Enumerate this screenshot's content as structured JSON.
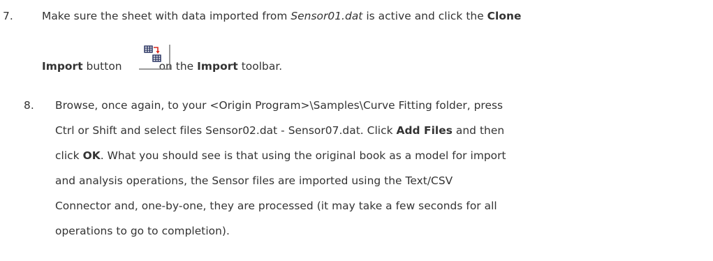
{
  "step7": {
    "number": "7.",
    "text_before_file": "Make sure the sheet with data imported from ",
    "file_name": "Sensor01.dat",
    "text_after_file": " is active and click the ",
    "clone_label": "Clone",
    "import_label": "Import",
    "button_word": " button ",
    "icon_name": "clone-import-icon",
    "text_on_the": "on the ",
    "toolbar_name": "Import",
    "text_toolbar": " toolbar."
  },
  "step8": {
    "number": "8.",
    "line1": "Browse, once again, to your <Origin Program>\\Samples\\Curve Fitting folder, press",
    "line2": "Ctrl or Shift and select files Sensor02.dat - Sensor07.dat. Click ",
    "add_files_label": "Add Files",
    "line2_end": " and then",
    "line3_start": "click ",
    "ok_label": "OK",
    "line3_end": ". What you should see is that using the original book as a model for import",
    "line4": "and analysis operations, the Sensor files are imported using the Text/CSV",
    "line5": "Connector and, one-by-one, they are processed (it may take a few seconds for all",
    "line6": "operations to go to completion)."
  },
  "colors": {
    "text": "#333333",
    "icon_grid": "#1f2a5a",
    "icon_arrow": "#d9281e",
    "icon_border": "#7a7a7a"
  }
}
